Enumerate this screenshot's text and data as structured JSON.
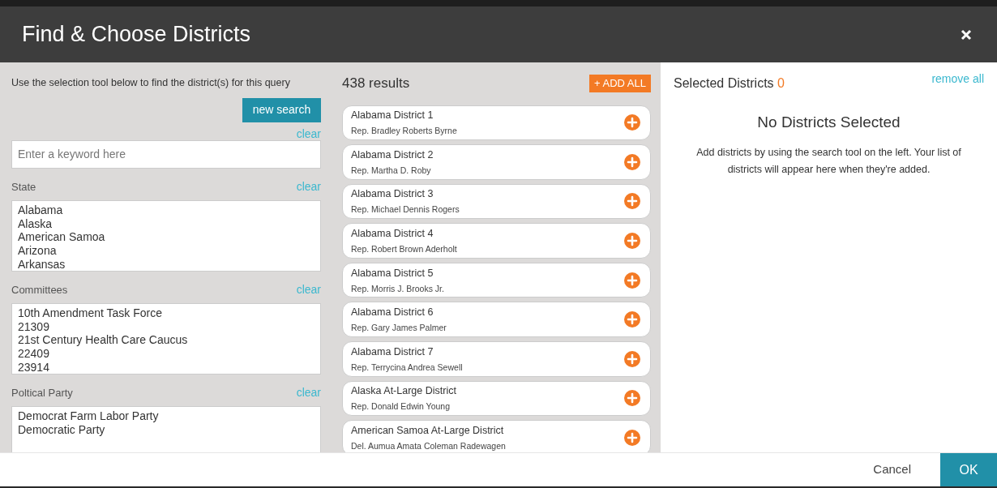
{
  "dialog": {
    "title": "Find & Choose Districts"
  },
  "search_panel": {
    "instructions": "Use the selection tool below to find the district(s) for this query",
    "new_search_button": "new search",
    "keyword": {
      "clear": "clear",
      "placeholder": "Enter a keyword here"
    },
    "filters": [
      {
        "label": "State",
        "clear": "clear",
        "options": [
          "Alabama",
          "Alaska",
          "American Samoa",
          "Arizona",
          "Arkansas"
        ]
      },
      {
        "label": "Committees",
        "clear": "clear",
        "options": [
          "10th Amendment Task Force",
          "21309",
          "21st Century Health Care Caucus",
          "22409",
          "23914"
        ]
      },
      {
        "label": "Poltical Party",
        "clear": "clear",
        "options": [
          "Democrat Farm Labor Party",
          "Democratic Party"
        ]
      }
    ]
  },
  "results": {
    "count": "438 results",
    "add_all_button": "+ ADD ALL",
    "items": [
      {
        "name": "Alabama District 1",
        "representative": "Rep. Bradley Roberts Byrne"
      },
      {
        "name": "Alabama District 2",
        "representative": "Rep. Martha D. Roby"
      },
      {
        "name": "Alabama District 3",
        "representative": "Rep. Michael Dennis Rogers"
      },
      {
        "name": "Alabama District 4",
        "representative": "Rep. Robert Brown Aderholt"
      },
      {
        "name": "Alabama District 5",
        "representative": "Rep. Morris J. Brooks Jr."
      },
      {
        "name": "Alabama District 6",
        "representative": "Rep. Gary James Palmer"
      },
      {
        "name": "Alabama District 7",
        "representative": "Rep. Terrycina Andrea Sewell"
      },
      {
        "name": "Alaska At-Large District",
        "representative": "Rep. Donald Edwin Young"
      },
      {
        "name": "American Samoa At-Large District",
        "representative": "Del. Aumua Amata Coleman Radewagen"
      }
    ]
  },
  "selected_panel": {
    "title": "Selected Districts",
    "count": "0",
    "remove_all": "remove all",
    "empty_title": "No Districts Selected",
    "empty_text": "Add districts by using the search tool on the left. Your list of districts will appear here when they're added."
  },
  "footer": {
    "cancel": "Cancel",
    "ok": "OK"
  }
}
